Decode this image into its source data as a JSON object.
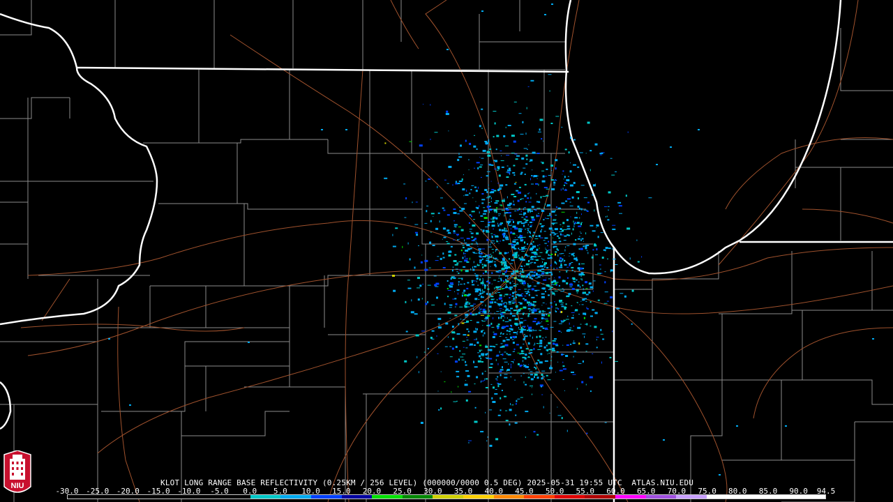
{
  "product": {
    "title": "KLOT LONG RANGE BASE REFLECTIVITY (0.25KM / 256 LEVEL) (000000/0000 0.5 DEG) 2025-05-31 19:55 UTC  ATLAS.NIU.EDU"
  },
  "logo": {
    "text": "NIU",
    "color": "#c8102e",
    "icon": "niu-tower-logo"
  },
  "colorbar": {
    "labels": [
      "-30.0",
      "-25.0",
      "-20.0",
      "-15.0",
      "-10.0",
      "-5.0",
      "0.0",
      "5.0",
      "10.0",
      "15.0",
      "20.0",
      "25.0",
      "30.0",
      "35.0",
      "40.0",
      "45.0",
      "50.0",
      "55.0",
      "60.0",
      "65.0",
      "70.0",
      "75.0",
      "80.0",
      "85.0",
      "90.0",
      "94.5"
    ],
    "segments": [
      {
        "from": -30,
        "to": 0,
        "color": "#000000"
      },
      {
        "from": 0,
        "to": 5,
        "color": "#00c8c8"
      },
      {
        "from": 5,
        "to": 10,
        "color": "#00aaf0"
      },
      {
        "from": 10,
        "to": 15,
        "color": "#0040ff"
      },
      {
        "from": 15,
        "to": 20,
        "color": "#0000a0"
      },
      {
        "from": 20,
        "to": 25,
        "color": "#00e000"
      },
      {
        "from": 25,
        "to": 30,
        "color": "#008800"
      },
      {
        "from": 30,
        "to": 35,
        "color": "#d0d000"
      },
      {
        "from": 35,
        "to": 40,
        "color": "#ffd000"
      },
      {
        "from": 40,
        "to": 45,
        "color": "#ff8800"
      },
      {
        "from": 45,
        "to": 50,
        "color": "#ff4000"
      },
      {
        "from": 50,
        "to": 55,
        "color": "#e00000"
      },
      {
        "from": 55,
        "to": 60,
        "color": "#b00000"
      },
      {
        "from": 60,
        "to": 65,
        "color": "#ff00ff"
      },
      {
        "from": 65,
        "to": 70,
        "color": "#a050e0"
      },
      {
        "from": 70,
        "to": 75,
        "color": "#c8a0ff"
      },
      {
        "from": 75,
        "to": 94.5,
        "color": "#ffffff"
      }
    ]
  },
  "map_style": {
    "background": "#000000",
    "state_border_color": "#ffffff",
    "county_border_color": "#8c8c8c",
    "road_color": "#a0522d",
    "echo_colors": [
      "#00c8c8",
      "#00aaf0",
      "#0040ff",
      "#00e000",
      "#d0d000"
    ]
  }
}
